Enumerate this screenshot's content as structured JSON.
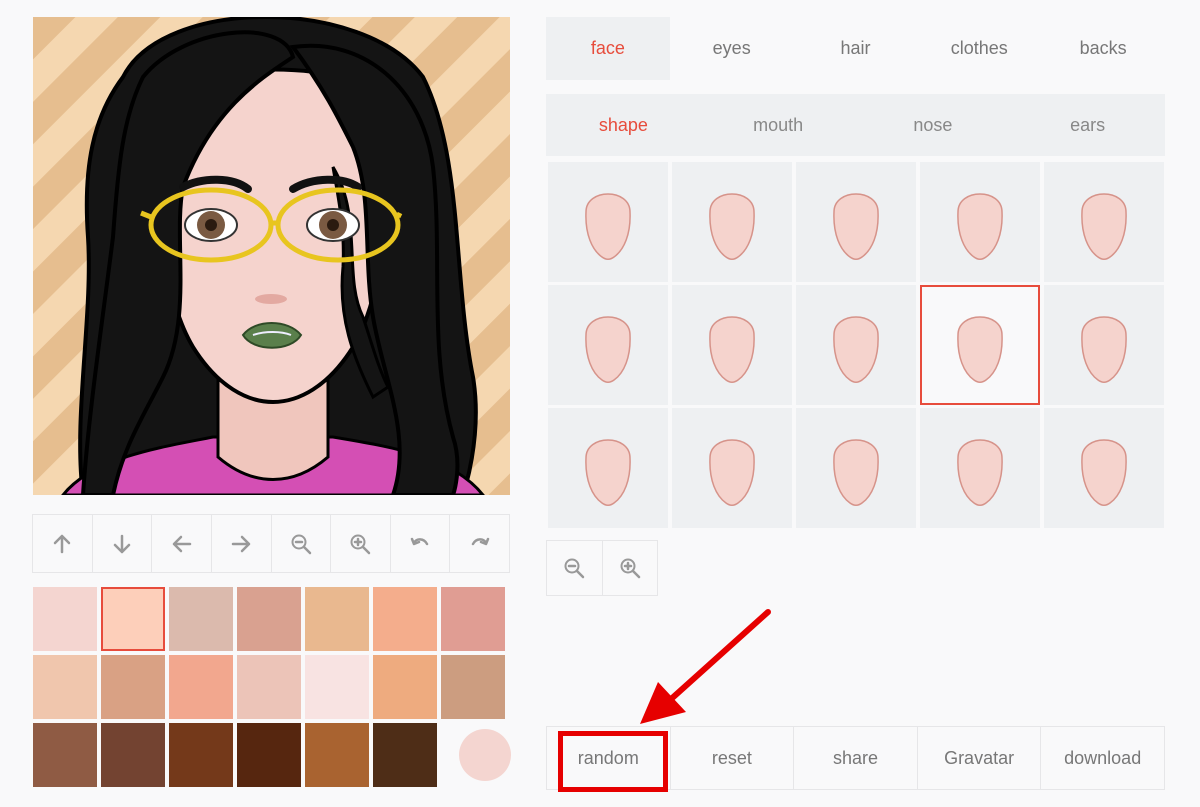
{
  "main_tabs": [
    "face",
    "eyes",
    "hair",
    "clothes",
    "backs"
  ],
  "main_tab_active": 0,
  "sub_tabs": [
    "shape",
    "mouth",
    "nose",
    "ears"
  ],
  "sub_tab_active": 0,
  "toolbar_icons": [
    "arrow-up-icon",
    "arrow-down-icon",
    "arrow-left-icon",
    "arrow-right-icon",
    "zoom-out-icon",
    "zoom-in-icon",
    "rotate-left-icon",
    "rotate-right-icon"
  ],
  "palette": [
    [
      "#f4d5d0",
      "#fdcfba",
      "#dbbaad",
      "#d9a190",
      "#e9b88f",
      "#f4ad8c",
      "#e09d93"
    ],
    [
      "#f0c6ad",
      "#d9a184",
      "#f2a78e",
      "#ecc4b8",
      "#f8e3e2",
      "#eeab7f",
      "#cc9d80"
    ],
    [
      "#8f5b44",
      "#734331",
      "#74391a",
      "#56260f",
      "#a96330",
      "#4e2d17",
      "#f4d5d0"
    ]
  ],
  "palette_selected": [
    0,
    1
  ],
  "shape_grid": {
    "rows": 3,
    "cols": 5,
    "selected": [
      1,
      3
    ]
  },
  "zoom_icons": [
    "zoom-out-icon",
    "zoom-in-icon"
  ],
  "actions": [
    "random",
    "reset",
    "share",
    "Gravatar",
    "download"
  ],
  "colors": {
    "accent": "#e74c3c",
    "skin": "#f5d3cd",
    "skin_outline": "#d6938a",
    "annotation": "#e60000"
  }
}
